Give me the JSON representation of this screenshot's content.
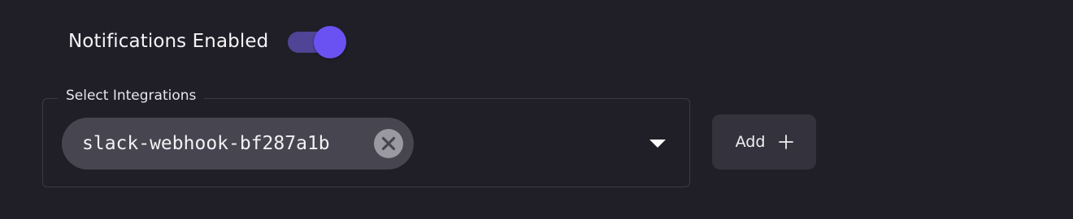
{
  "notifications": {
    "label": "Notifications Enabled",
    "enabled": true
  },
  "integrations": {
    "legend": "Select Integrations",
    "selected": [
      {
        "label": "slack-webhook-bf287a1b"
      }
    ]
  },
  "add_button": {
    "label": "Add",
    "icon": "plus-icon"
  },
  "colors": {
    "background": "#201f27",
    "accent": "#6a52f2",
    "toggle_track": "#4f4496",
    "chip": "#464550",
    "button": "#34333d"
  }
}
